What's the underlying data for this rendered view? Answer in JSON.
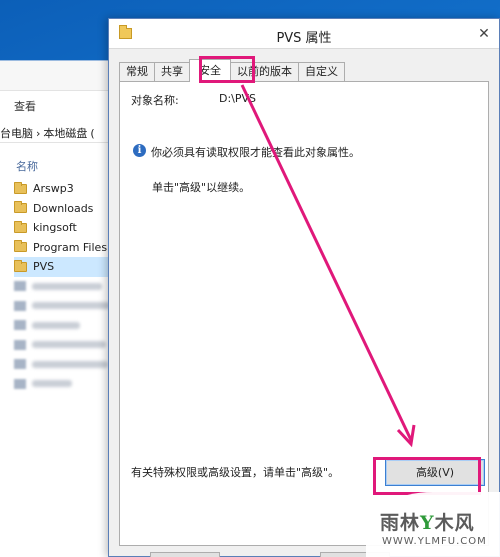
{
  "explorer": {
    "view_tab": "查看",
    "breadcrumb": [
      "台电脑",
      "›",
      "本地磁盘",
      "("
    ],
    "column_name": "名称",
    "items": [
      {
        "label": "Arswp3",
        "selected": false
      },
      {
        "label": "Downloads",
        "selected": false
      },
      {
        "label": "kingsoft",
        "selected": false
      },
      {
        "label": "Program Files",
        "selected": false
      },
      {
        "label": "PVS",
        "selected": true
      }
    ]
  },
  "dialog": {
    "title": "PVS 属性",
    "tabs": [
      "常规",
      "共享",
      "安全",
      "以前的版本",
      "自定义"
    ],
    "active_tab": "安全",
    "object_name_label": "对象名称:",
    "object_name_value": "D:\\PVS",
    "info_message": "你必须具有读取权限才能查看此对象属性。",
    "continue_message": "单击\"高级\"以继续。",
    "advanced_hint": "有关特殊权限或高级设置，请单击\"高级\"。",
    "advanced_button": "高级(V)"
  },
  "annotation": {
    "highlight_color": "#e0187a"
  },
  "watermark": {
    "main": "雨林",
    "mid": "木风",
    "sub": "WWW.YLMFU.COM"
  }
}
